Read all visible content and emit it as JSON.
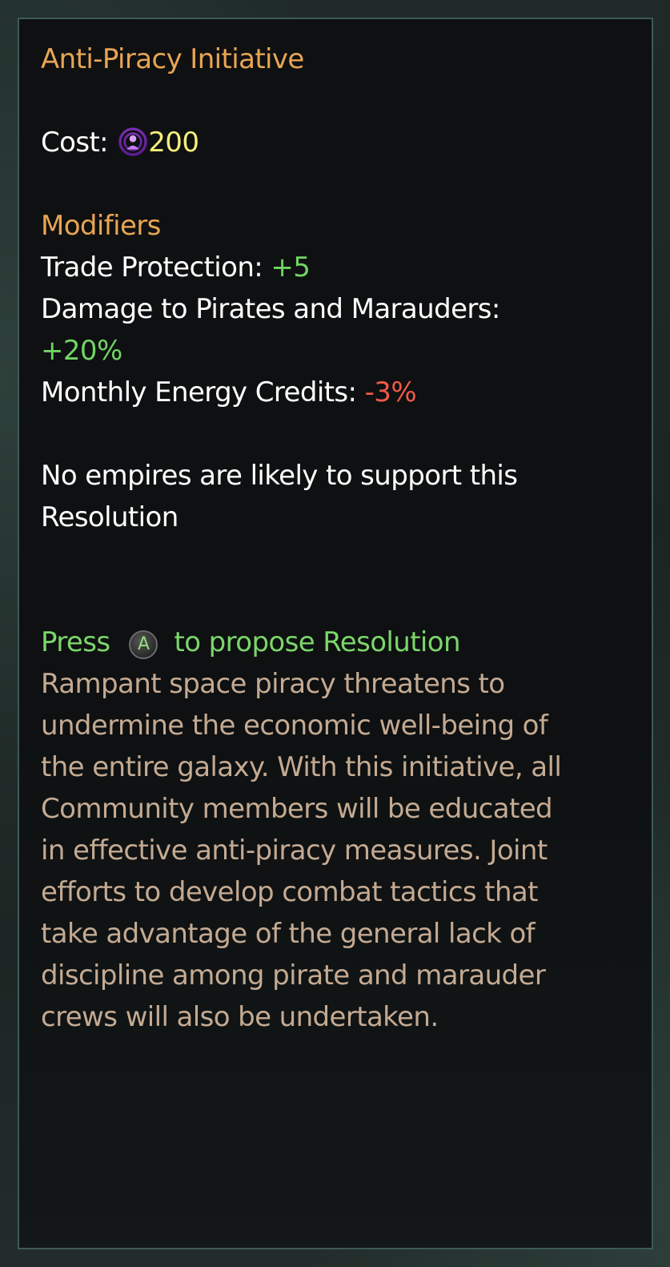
{
  "tooltip": {
    "title": "Anti-Piracy Initiative",
    "cost_label": "Cost:",
    "cost_icon": "influence-icon",
    "cost_value": "200",
    "modifiers_heading": "Modifiers",
    "modifiers": [
      {
        "label": "Trade Protection:",
        "value": "+5",
        "tone": "positive"
      },
      {
        "label": "Damage to Pirates and Marauders:",
        "value": "+20%",
        "tone": "positive"
      },
      {
        "label": "Monthly Energy Credits:",
        "value": "-3%",
        "tone": "negative"
      }
    ],
    "support_line_1": "No empires are likely to support this",
    "support_line_2": "Resolution",
    "press_label": "Press",
    "button_glyph": "A",
    "propose_label": "to propose Resolution",
    "description_lines": [
      "Rampant space piracy threatens to",
      "undermine the economic well-being of",
      "the entire galaxy. With this initiative, all",
      "Community members will be educated",
      "in effective anti-piracy measures. Joint",
      "efforts to develop combat tactics that",
      "take advantage of the general lack of",
      "discipline among pirate and marauder",
      "crews will also be undertaken."
    ]
  },
  "colors": {
    "title": "#e8a553",
    "positive": "#71d563",
    "negative": "#ee5a48",
    "cost_value": "#f6ef7a",
    "description": "#c4aa92",
    "frame": "#3d5a56"
  }
}
